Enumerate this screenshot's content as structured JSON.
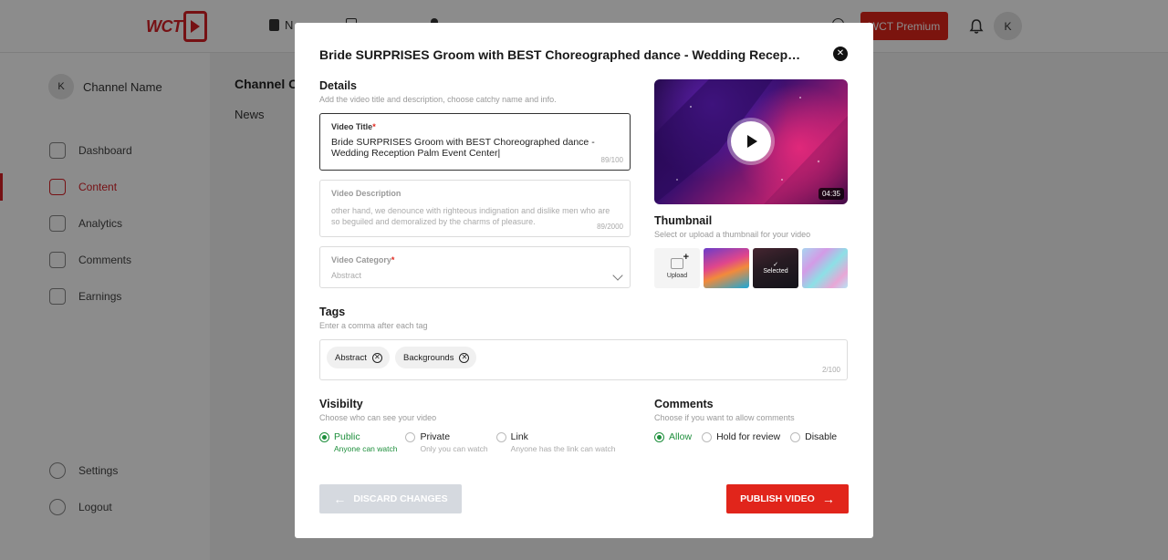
{
  "app": {
    "logo_text": "WCT",
    "nav": [
      "N",
      "",
      ""
    ],
    "premium_label": "WCT Premium",
    "avatar_letter": "K",
    "colors": {
      "brand": "#e1251b",
      "success": "#1e8f3c"
    }
  },
  "sidebar": {
    "channel_avatar": "K",
    "channel_name": "Channel Name",
    "items": [
      {
        "label": "Dashboard",
        "icon": "dashboard-icon"
      },
      {
        "label": "Content",
        "icon": "content-icon",
        "active": true
      },
      {
        "label": "Analytics",
        "icon": "analytics-icon"
      },
      {
        "label": "Comments",
        "icon": "comments-icon"
      },
      {
        "label": "Earnings",
        "icon": "earnings-icon"
      }
    ],
    "footer": [
      {
        "label": "Settings",
        "icon": "gear-icon"
      },
      {
        "label": "Logout",
        "icon": "logout-icon"
      }
    ]
  },
  "main": {
    "title": "Channel Co",
    "tab": "News"
  },
  "modal": {
    "title": "Bride SURPRISES Groom with BEST Choreographed dance - Wedding Reception P...",
    "close_icon": "close-icon",
    "details": {
      "heading": "Details",
      "subtitle": "Add the video title and description, choose catchy name and info.",
      "video_title": {
        "label": "Video Title",
        "required_mark": "*",
        "value": "Bride SURPRISES Groom with BEST Choreographed dance - Wedding Reception Palm Event Center|",
        "counter": "89/100"
      },
      "video_description": {
        "label": "Video Description",
        "value": "other hand, we denounce with righteous indignation and dislike men who are so beguiled and demoralized by the charms of pleasure.",
        "counter": "89/2000"
      },
      "video_category": {
        "label": "Video Category",
        "required_mark": "*",
        "value": "Abstract"
      }
    },
    "player": {
      "duration": "04:35"
    },
    "thumbnail": {
      "heading": "Thumbnail",
      "subtitle": "Select or upload a thumbnail for your video",
      "upload_label": "Upload",
      "selected_label": "Selected"
    },
    "tags": {
      "heading": "Tags",
      "subtitle": "Enter a comma after each tag",
      "items": [
        "Abstract",
        "Backgrounds"
      ],
      "counter": "2/100"
    },
    "visibility": {
      "heading": "Visibilty",
      "subtitle": "Choose who can see your video",
      "options": [
        {
          "label": "Public",
          "sub": "Anyone can watch",
          "selected": true
        },
        {
          "label": "Private",
          "sub": "Only you can watch",
          "selected": false
        },
        {
          "label": "Link",
          "sub": "Anyone has the link can watch",
          "selected": false
        }
      ]
    },
    "comments": {
      "heading": "Comments",
      "subtitle": "Choose if you want to allow comments",
      "options": [
        {
          "label": "Allow",
          "selected": true
        },
        {
          "label": "Hold for review",
          "selected": false
        },
        {
          "label": "Disable",
          "selected": false
        }
      ]
    },
    "actions": {
      "discard_label": "DISCARD CHANGES",
      "publish_label": "PUBLISH VIDEO"
    }
  }
}
